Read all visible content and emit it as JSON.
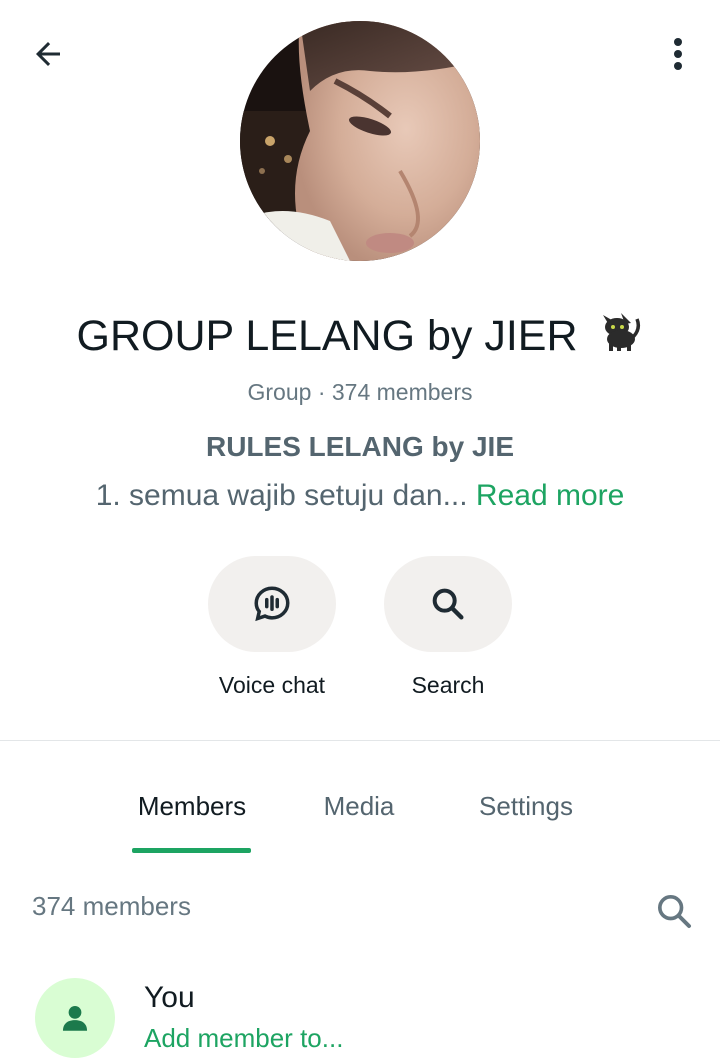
{
  "header": {
    "back_icon": "arrow-left-icon",
    "menu_icon": "more-vertical-icon"
  },
  "profile": {
    "avatar_alt": "group-photo",
    "name": "GROUP LELANG by JIER",
    "name_emoji": "black-cat-emoji",
    "meta": "Group · 374 members"
  },
  "description": {
    "title": "RULES LELANG by JIE",
    "preview": "1. semua wajib setuju dan... ",
    "read_more": "Read more"
  },
  "actions": [
    {
      "label": "Voice chat",
      "icon": "voice-chat-icon"
    },
    {
      "label": "Search",
      "icon": "search-icon"
    }
  ],
  "tabs": [
    {
      "label": "Members",
      "active": true
    },
    {
      "label": "Media",
      "active": false
    },
    {
      "label": "Settings",
      "active": false
    }
  ],
  "members": {
    "count_label": "374 members",
    "list": [
      {
        "name": "You",
        "subtitle": "Add member to..."
      }
    ]
  },
  "colors": {
    "accent": "#1da462",
    "text_primary": "#111b21",
    "text_secondary": "#54656f",
    "chip_bg": "#f2f0ee",
    "member_avatar_bg": "#d9fdd3"
  }
}
